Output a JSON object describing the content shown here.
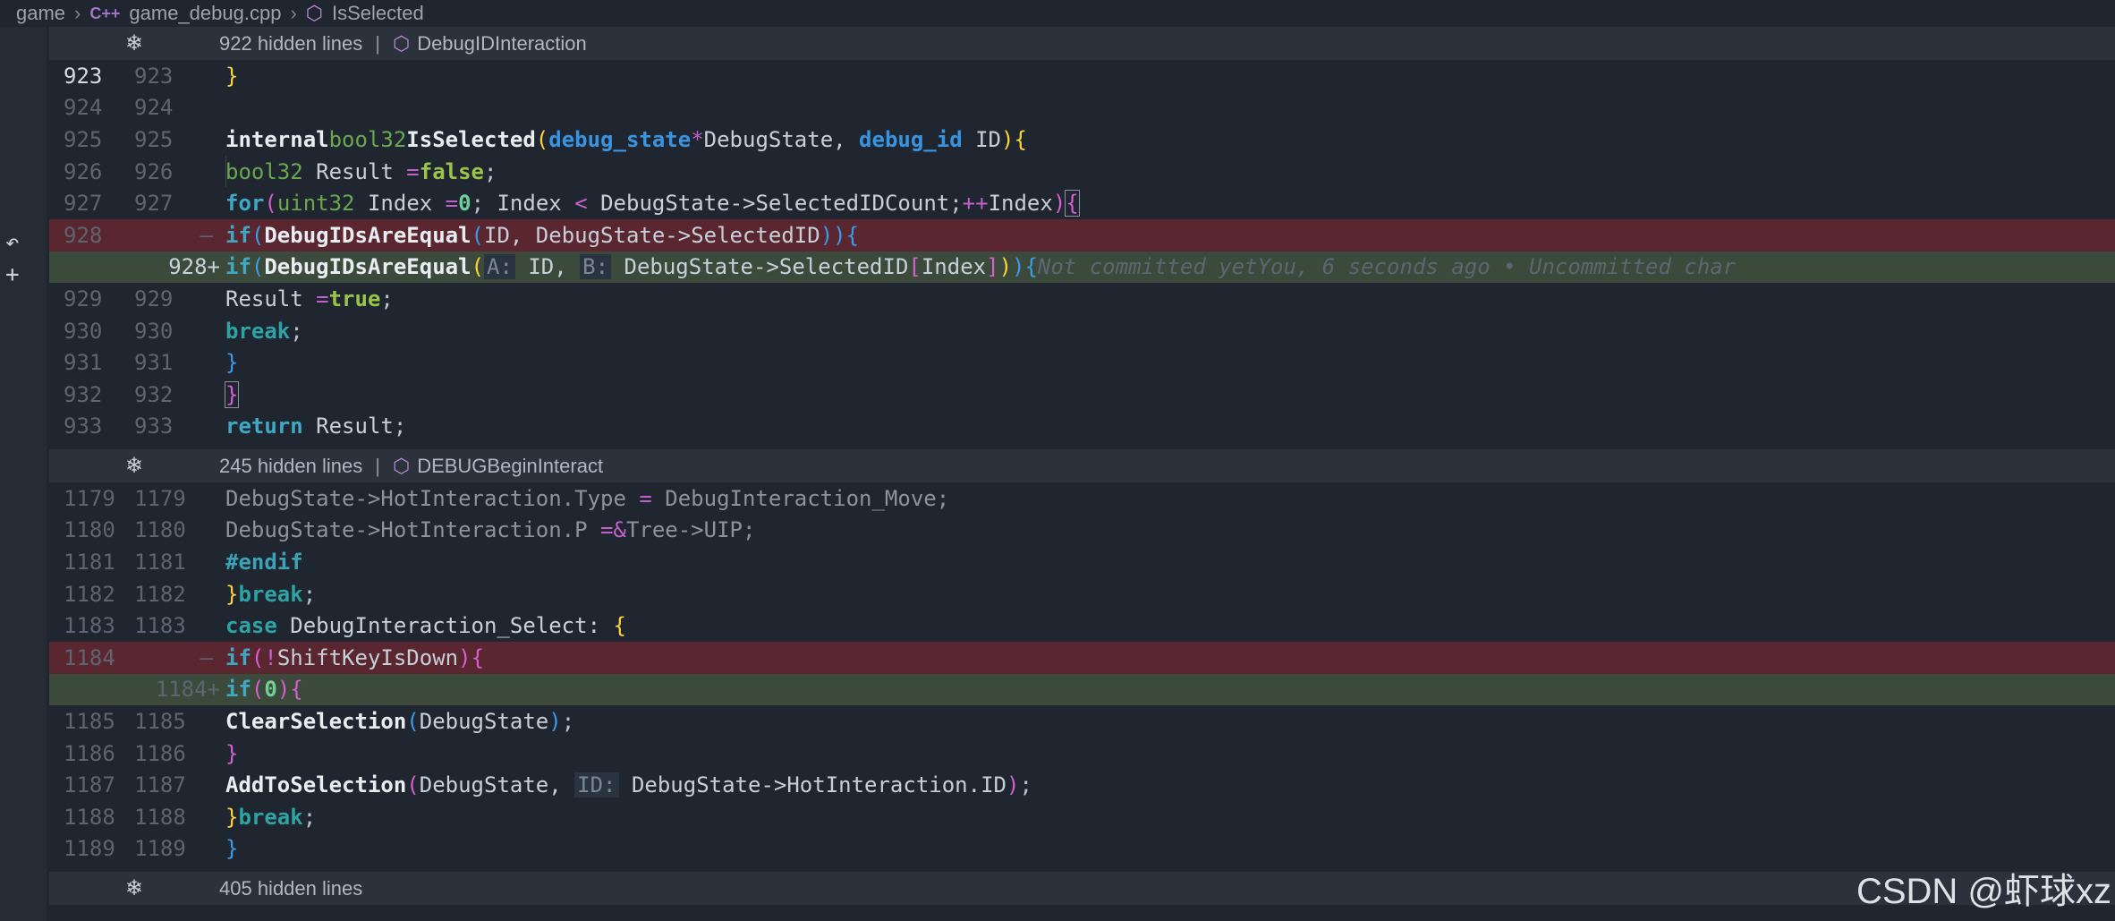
{
  "breadcrumb": {
    "root": "game",
    "file": "game_debug.cpp",
    "file_badge": "C++",
    "symbol": "IsSelected"
  },
  "folds": [
    {
      "text": "922 hidden lines",
      "symbol": "DebugIDInteraction"
    },
    {
      "text": "245 hidden lines",
      "symbol": "DEBUGBeginInteract"
    },
    {
      "text": "405 hidden lines",
      "symbol": ""
    }
  ],
  "blame": {
    "status": "Not committed yet",
    "detail": "You, 6 seconds ago • Uncommitted char"
  },
  "lines": {
    "l923": {
      "a": "923",
      "b": "923"
    },
    "l924": {
      "a": "924",
      "b": "924"
    },
    "l925": {
      "a": "925",
      "b": "925"
    },
    "l926": {
      "a": "926",
      "b": "926"
    },
    "l927": {
      "a": "927",
      "b": "927"
    },
    "l928del": {
      "a": "928",
      "b": "—"
    },
    "l928add": {
      "a": "",
      "b": "928+"
    },
    "l929": {
      "a": "929",
      "b": "929"
    },
    "l930": {
      "a": "930",
      "b": "930"
    },
    "l931": {
      "a": "931",
      "b": "931"
    },
    "l932": {
      "a": "932",
      "b": "932"
    },
    "l933": {
      "a": "933",
      "b": "933"
    },
    "l1179": {
      "a": "1179",
      "b": "1179"
    },
    "l1180": {
      "a": "1180",
      "b": "1180"
    },
    "l1181": {
      "a": "1181",
      "b": "1181"
    },
    "l1182": {
      "a": "1182",
      "b": "1182"
    },
    "l1183": {
      "a": "1183",
      "b": "1183"
    },
    "l1184del": {
      "a": "1184",
      "b": "—"
    },
    "l1184add": {
      "a": "",
      "b": "1184+"
    },
    "l1185": {
      "a": "1185",
      "b": "1185"
    },
    "l1186": {
      "a": "1186",
      "b": "1186"
    },
    "l1187": {
      "a": "1187",
      "b": "1187"
    },
    "l1188": {
      "a": "1188",
      "b": "1188"
    },
    "l1189": {
      "a": "1189",
      "b": "1189"
    }
  },
  "watermark": "CSDN @虾球xz"
}
